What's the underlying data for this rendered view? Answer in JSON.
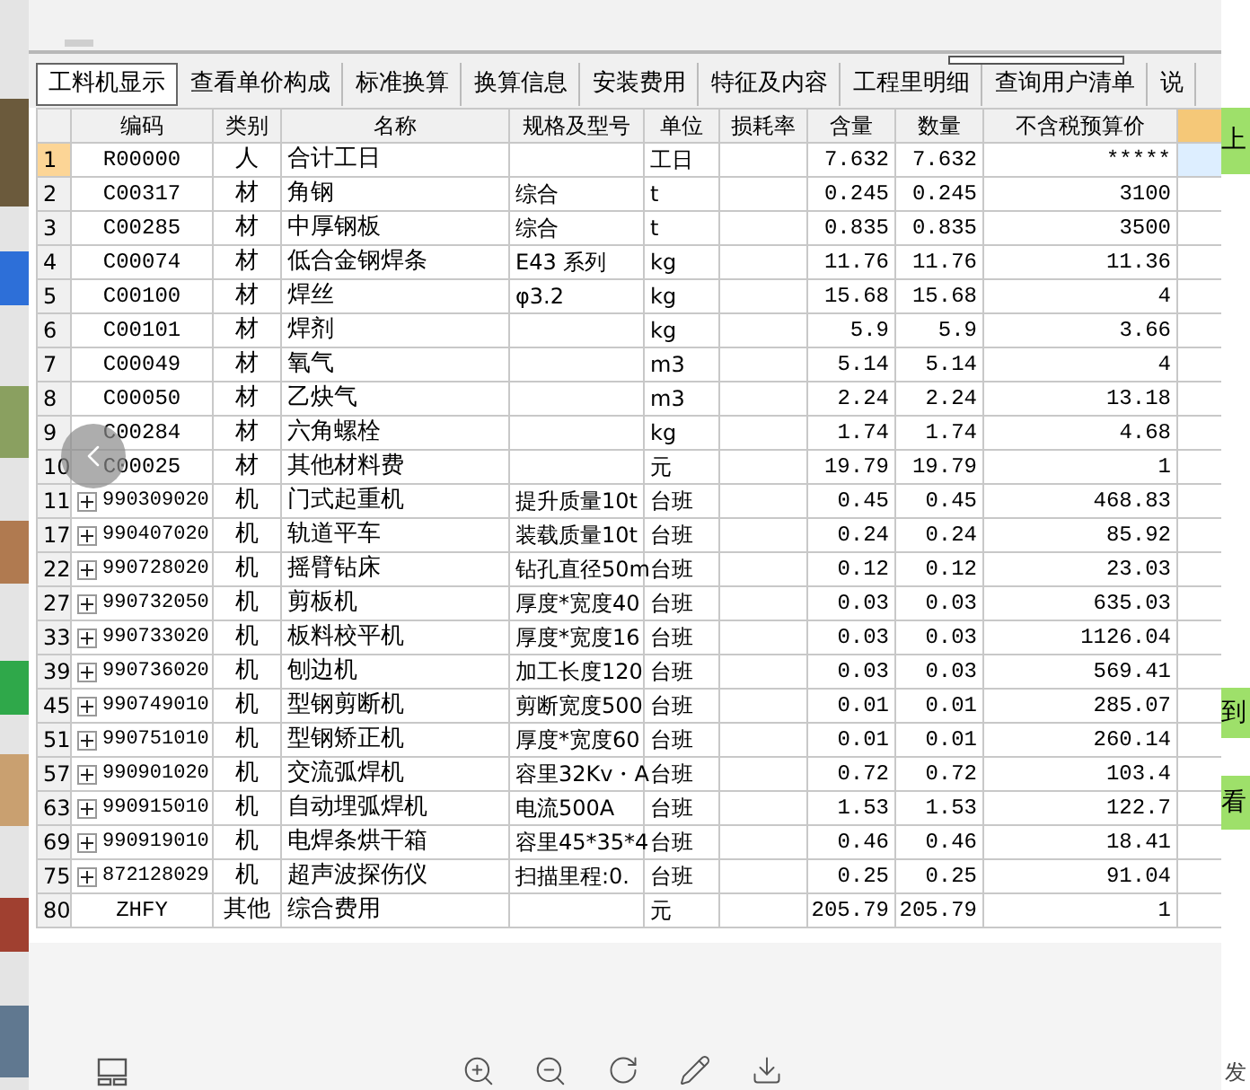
{
  "tabs": [
    {
      "label": "工料机显示",
      "selected": true
    },
    {
      "label": "查看单价构成",
      "selected": false
    },
    {
      "label": "标准换算",
      "selected": false
    },
    {
      "label": "换算信息",
      "selected": false
    },
    {
      "label": "安装费用",
      "selected": false
    },
    {
      "label": "特征及内容",
      "selected": false
    },
    {
      "label": "工程里明细",
      "selected": false
    },
    {
      "label": "查询用户清单",
      "selected": false
    },
    {
      "label": "说",
      "selected": false
    }
  ],
  "table": {
    "columns": [
      "编码",
      "类别",
      "名称",
      "规格及型号",
      "单位",
      "损耗率",
      "含量",
      "数量",
      "不含税预算价"
    ],
    "rows": [
      {
        "no": "1",
        "code": "R00000",
        "type": "人",
        "name": "合计工日",
        "spec": "",
        "unit": "工日",
        "loss": "",
        "content": "7.632",
        "qty": "7.632",
        "price": "*****",
        "selected": true,
        "kind": "item"
      },
      {
        "no": "2",
        "code": "C00317",
        "type": "材",
        "name": "角钢",
        "spec": "综合",
        "unit": "t",
        "loss": "",
        "content": "0.245",
        "qty": "0.245",
        "price": "3100",
        "selected": false,
        "kind": "item"
      },
      {
        "no": "3",
        "code": "C00285",
        "type": "材",
        "name": "中厚钢板",
        "spec": "综合",
        "unit": "t",
        "loss": "",
        "content": "0.835",
        "qty": "0.835",
        "price": "3500",
        "selected": false,
        "kind": "item"
      },
      {
        "no": "4",
        "code": "C00074",
        "type": "材",
        "name": "低合金钢焊条",
        "spec": "E43 系列",
        "unit": "kg",
        "loss": "",
        "content": "11.76",
        "qty": "11.76",
        "price": "11.36",
        "selected": false,
        "kind": "item"
      },
      {
        "no": "5",
        "code": "C00100",
        "type": "材",
        "name": "焊丝",
        "spec": "φ3.2",
        "unit": "kg",
        "loss": "",
        "content": "15.68",
        "qty": "15.68",
        "price": "4",
        "selected": false,
        "kind": "item"
      },
      {
        "no": "6",
        "code": "C00101",
        "type": "材",
        "name": "焊剂",
        "spec": "",
        "unit": "kg",
        "loss": "",
        "content": "5.9",
        "qty": "5.9",
        "price": "3.66",
        "selected": false,
        "kind": "item"
      },
      {
        "no": "7",
        "code": "C00049",
        "type": "材",
        "name": "氧气",
        "spec": "",
        "unit": "m3",
        "loss": "",
        "content": "5.14",
        "qty": "5.14",
        "price": "4",
        "selected": false,
        "kind": "item"
      },
      {
        "no": "8",
        "code": "C00050",
        "type": "材",
        "name": "乙炔气",
        "spec": "",
        "unit": "m3",
        "loss": "",
        "content": "2.24",
        "qty": "2.24",
        "price": "13.18",
        "selected": false,
        "kind": "item"
      },
      {
        "no": "9",
        "code": "C00284",
        "type": "材",
        "name": "六角螺栓",
        "spec": "",
        "unit": "kg",
        "loss": "",
        "content": "1.74",
        "qty": "1.74",
        "price": "4.68",
        "selected": false,
        "kind": "item"
      },
      {
        "no": "10",
        "code": "C00025",
        "type": "材",
        "name": "其他材料费",
        "spec": "",
        "unit": "元",
        "loss": "",
        "content": "19.79",
        "qty": "19.79",
        "price": "1",
        "selected": false,
        "kind": "item"
      },
      {
        "no": "11",
        "code": "990309020",
        "type": "机",
        "name": "门式起重机",
        "spec": "提升质量10t",
        "unit": "台班",
        "loss": "",
        "content": "0.45",
        "qty": "0.45",
        "price": "468.83",
        "selected": false,
        "kind": "group",
        "expanded": false
      },
      {
        "no": "17",
        "code": "990407020",
        "type": "机",
        "name": "轨道平车",
        "spec": "装载质量10t",
        "unit": "台班",
        "loss": "",
        "content": "0.24",
        "qty": "0.24",
        "price": "85.92",
        "selected": false,
        "kind": "group",
        "expanded": false
      },
      {
        "no": "22",
        "code": "990728020",
        "type": "机",
        "name": "摇臂钻床",
        "spec": "钻孔直径50m",
        "unit": "台班",
        "loss": "",
        "content": "0.12",
        "qty": "0.12",
        "price": "23.03",
        "selected": false,
        "kind": "group",
        "expanded": false
      },
      {
        "no": "27",
        "code": "990732050",
        "type": "机",
        "name": "剪板机",
        "spec": "厚度*宽度40",
        "unit": "台班",
        "loss": "",
        "content": "0.03",
        "qty": "0.03",
        "price": "635.03",
        "selected": false,
        "kind": "group",
        "expanded": false
      },
      {
        "no": "33",
        "code": "990733020",
        "type": "机",
        "name": "板料校平机",
        "spec": "厚度*宽度16",
        "unit": "台班",
        "loss": "",
        "content": "0.03",
        "qty": "0.03",
        "price": "1126.04",
        "selected": false,
        "kind": "group",
        "expanded": false
      },
      {
        "no": "39",
        "code": "990736020",
        "type": "机",
        "name": "刨边机",
        "spec": "加工长度120",
        "unit": "台班",
        "loss": "",
        "content": "0.03",
        "qty": "0.03",
        "price": "569.41",
        "selected": false,
        "kind": "group",
        "expanded": false
      },
      {
        "no": "45",
        "code": "990749010",
        "type": "机",
        "name": "型钢剪断机",
        "spec": "剪断宽度500",
        "unit": "台班",
        "loss": "",
        "content": "0.01",
        "qty": "0.01",
        "price": "285.07",
        "selected": false,
        "kind": "group",
        "expanded": false
      },
      {
        "no": "51",
        "code": "990751010",
        "type": "机",
        "name": "型钢矫正机",
        "spec": "厚度*宽度60",
        "unit": "台班",
        "loss": "",
        "content": "0.01",
        "qty": "0.01",
        "price": "260.14",
        "selected": false,
        "kind": "group",
        "expanded": false
      },
      {
        "no": "57",
        "code": "990901020",
        "type": "机",
        "name": "交流弧焊机",
        "spec": "容里32Kv・A",
        "unit": "台班",
        "loss": "",
        "content": "0.72",
        "qty": "0.72",
        "price": "103.4",
        "selected": false,
        "kind": "group",
        "expanded": false
      },
      {
        "no": "63",
        "code": "990915010",
        "type": "机",
        "name": "自动埋弧焊机",
        "spec": "电流500A",
        "unit": "台班",
        "loss": "",
        "content": "1.53",
        "qty": "1.53",
        "price": "122.7",
        "selected": false,
        "kind": "group",
        "expanded": false
      },
      {
        "no": "69",
        "code": "990919010",
        "type": "机",
        "name": "电焊条烘干箱",
        "spec": "容里45*35*4",
        "unit": "台班",
        "loss": "",
        "content": "0.46",
        "qty": "0.46",
        "price": "18.41",
        "selected": false,
        "kind": "group",
        "expanded": false
      },
      {
        "no": "75",
        "code": "872128029",
        "type": "机",
        "name": "超声波探伤仪",
        "spec": "扫描里程:0.",
        "unit": "台班",
        "loss": "",
        "content": "0.25",
        "qty": "0.25",
        "price": "91.04",
        "selected": false,
        "kind": "group",
        "expanded": false
      },
      {
        "no": "80",
        "code": "ZHFY",
        "type": "其他",
        "name": "综合费用",
        "spec": "",
        "unit": "元",
        "loss": "",
        "content": "205.79",
        "qty": "205.79",
        "price": "1",
        "selected": false,
        "kind": "item"
      }
    ]
  },
  "side_buttons": [
    "上",
    "到",
    "看"
  ],
  "side_text": "发"
}
